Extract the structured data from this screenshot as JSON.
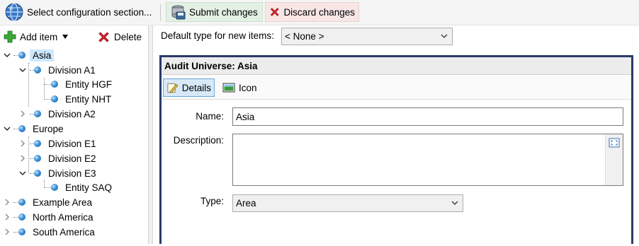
{
  "toolbar": {
    "select_config_label": "Select configuration section...",
    "submit_label": "Submit changes",
    "discard_label": "Discard changes"
  },
  "tree_toolbar": {
    "add_label": "Add item",
    "delete_label": "Delete"
  },
  "tree": {
    "items": [
      {
        "label": "Asia",
        "expanded": true,
        "selected": true
      },
      {
        "label": "Division A1",
        "expanded": true
      },
      {
        "label": "Entity HGF"
      },
      {
        "label": "Entity NHT"
      },
      {
        "label": "Division A2",
        "expanded": false
      },
      {
        "label": "Europe",
        "expanded": true
      },
      {
        "label": "Division E1",
        "expanded": false
      },
      {
        "label": "Division E2",
        "expanded": false
      },
      {
        "label": "Division E3",
        "expanded": true
      },
      {
        "label": "Entity SAQ"
      },
      {
        "label": "Example Area",
        "expanded": false
      },
      {
        "label": "North America",
        "expanded": false
      },
      {
        "label": "South America",
        "expanded": false
      }
    ]
  },
  "default_type": {
    "label": "Default type for new items:",
    "value": "< None >"
  },
  "detail": {
    "header": "Audit Universe: Asia",
    "tabs": [
      {
        "label": "Details",
        "active": true
      },
      {
        "label": "Icon",
        "active": false
      }
    ],
    "name_label": "Name:",
    "name_value": "Asia",
    "description_label": "Description:",
    "description_value": "",
    "type_label": "Type:",
    "type_value": "Area"
  },
  "colors": {
    "frame_border": "#2b3a6b",
    "selected_bg": "#cce8ff",
    "submit_bg": "#e4f0e4",
    "discard_bg": "#f8e6e6"
  }
}
